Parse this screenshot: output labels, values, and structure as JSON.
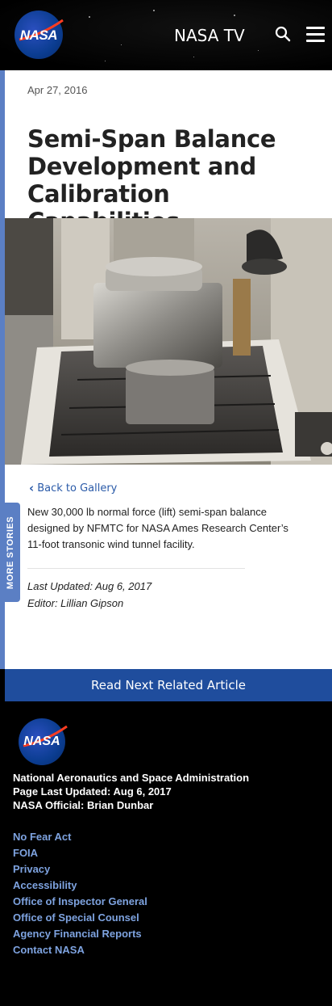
{
  "header": {
    "logo_text": "NASA",
    "nasa_tv_label": "NASA TV",
    "search_icon": "search-icon",
    "menu_icon": "hamburger-menu-icon"
  },
  "article": {
    "date": "Apr 27, 2016",
    "title": "Semi-Span Balance Development and Calibration Capabilities",
    "back_link": "Back to Gallery",
    "description": "New 30,000 lb normal force (lift) semi-span balance designed by NFMTC for NASA Ames Research Center’s 11-foot transonic wind tunnel facility.",
    "last_updated": "Last Updated: Aug 6, 2017",
    "editor": "Editor: Lillian Gipson"
  },
  "more_stories_tab": "MORE STORIES",
  "read_next": "Read Next Related Article",
  "footer": {
    "logo_text": "NASA",
    "agency": "National Aeronautics and Space Administration",
    "page_updated": "Page Last Updated: Aug 6, 2017",
    "official": "NASA Official: Brian Dunbar",
    "links": [
      "No Fear Act",
      "FOIA",
      "Privacy",
      "Accessibility",
      "Office of Inspector General",
      "Office of Special Counsel",
      "Agency Financial Reports",
      "Contact NASA"
    ]
  },
  "colors": {
    "accent_blue": "#1f4d9d",
    "link_blue": "#2a5aa8",
    "footer_link": "#7ea3e0",
    "tab_blue": "#5b7fc4"
  }
}
